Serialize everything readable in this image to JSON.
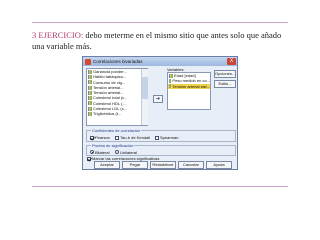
{
  "slide": {
    "caption_highlight": "3 EJERCICIO:",
    "caption_text": " debo meterme en el mismo sitio que antes solo que añado una variable más."
  },
  "dialog": {
    "title": "Correlaciones bivariadas",
    "close_label": "X",
    "source_variables": [
      "Ganancia ponder...",
      "Hábito tabáquico...",
      "Consumo de cig...",
      "Tensión arterial...",
      "Tensión arterial...",
      "Colesterol total (c...",
      "Colesterol HDL (...",
      "Colesterol LDL (c...",
      "Triglicéridos (t..."
    ],
    "move_label": "➔",
    "variables_label": "Variables:",
    "selected_variables": [
      {
        "label": "Edad [edad]",
        "selected": false
      },
      {
        "label": "Peso medido en co...",
        "selected": false
      },
      {
        "label": "Tensión arterial sist...",
        "selected": true
      }
    ],
    "side_buttons": [
      "Opciones...",
      "Estilo..."
    ],
    "correlation_group": {
      "title": "Coeficientes de correlación",
      "options": [
        {
          "label": "Pearson",
          "checked": true
        },
        {
          "label": "Tau-b de Kendall",
          "checked": false
        },
        {
          "label": "Spearman",
          "checked": false
        }
      ]
    },
    "significance_group": {
      "title": "Prueba de significación",
      "options": [
        {
          "label": "Bilateral",
          "checked": true
        },
        {
          "label": "Unilateral",
          "checked": false
        }
      ]
    },
    "flag_label": "Marcar las correlaciones significativas",
    "flag_checked": true,
    "buttons": [
      "Aceptar",
      "Pegar",
      "Restablecer",
      "Cancelar",
      "Ayuda"
    ]
  }
}
